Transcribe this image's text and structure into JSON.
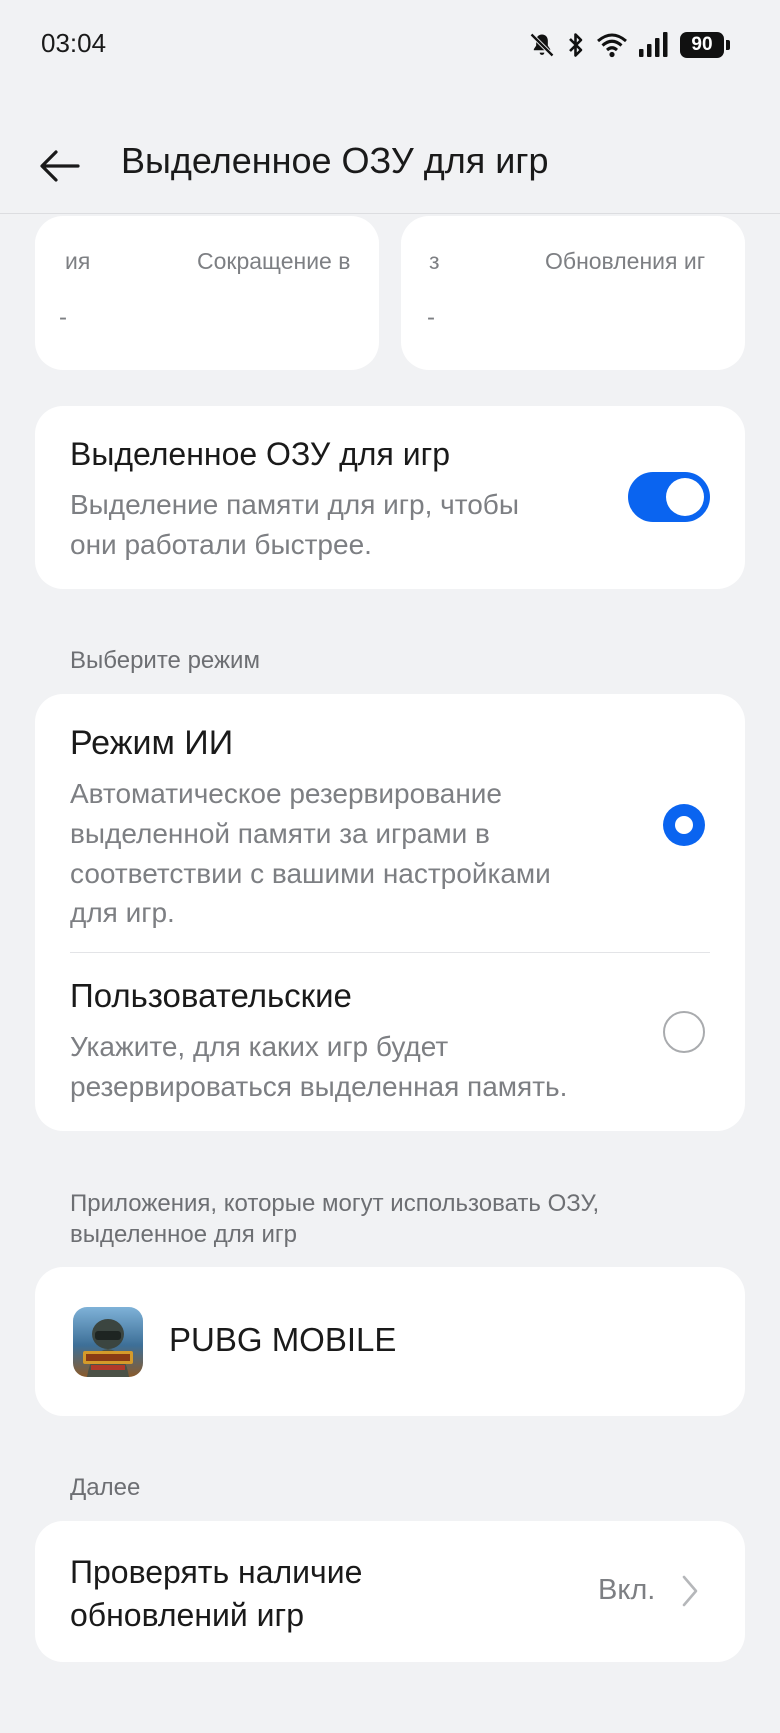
{
  "status_bar": {
    "time": "03:04",
    "battery": "90",
    "icons": [
      "bell-off-icon",
      "bluetooth-icon",
      "wifi-icon",
      "signal-icon",
      "battery-icon"
    ]
  },
  "header": {
    "back_icon": "back-arrow-icon",
    "title": "Выделенное ОЗУ для игр"
  },
  "stat_cards": [
    {
      "label_left": "ия",
      "label_right": "Сокращение в",
      "value": "-"
    },
    {
      "label_left": "з",
      "label_right": "Обновления иг",
      "value": "-"
    }
  ],
  "dedicated_ram": {
    "title": "Выделенное ОЗУ для игр",
    "subtitle_line1": "Выделение памяти для игр, чтобы",
    "subtitle_line2": "они работали быстрее.",
    "enabled": true,
    "accent_color": "#0a64f0"
  },
  "mode_section": {
    "label": "Выберите режим",
    "options": [
      {
        "title": "Режим ИИ",
        "lines": [
          "Автоматическое резервирование",
          "выделенной памяти за играми в",
          "соответствии с вашими настройками",
          "для игр."
        ],
        "selected": true
      },
      {
        "title": "Пользовательские",
        "lines": [
          "Укажите, для каких игр будет",
          "резервироваться выделенная память."
        ],
        "selected": false
      }
    ]
  },
  "apps_section": {
    "label_line1": "Приложения, которые могут использовать ОЗУ,",
    "label_line2": "выделенное для игр",
    "apps": [
      {
        "name": "PUBG MOBILE",
        "icon": "pubg-mobile-icon"
      }
    ]
  },
  "more_section": {
    "label": "Далее",
    "check_updates": {
      "title_line1": "Проверять наличие",
      "title_line2": "обновлений игр",
      "value": "Вкл.",
      "chevron_icon": "chevron-right-icon"
    }
  }
}
